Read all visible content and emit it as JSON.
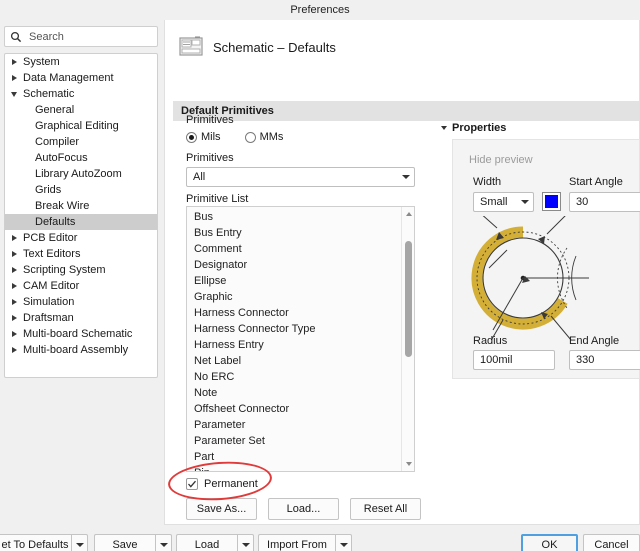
{
  "window": {
    "title": "Preferences"
  },
  "search": {
    "placeholder": "Search",
    "icon": "search-icon"
  },
  "sidebar": {
    "items": [
      {
        "label": "System",
        "level": 1,
        "expander": "right",
        "selected": false
      },
      {
        "label": "Data Management",
        "level": 1,
        "expander": "right",
        "selected": false
      },
      {
        "label": "Schematic",
        "level": 1,
        "expander": "down",
        "selected": false
      },
      {
        "label": "General",
        "level": 2,
        "expander": "none",
        "selected": false
      },
      {
        "label": "Graphical Editing",
        "level": 2,
        "expander": "none",
        "selected": false
      },
      {
        "label": "Compiler",
        "level": 2,
        "expander": "none",
        "selected": false
      },
      {
        "label": "AutoFocus",
        "level": 2,
        "expander": "none",
        "selected": false
      },
      {
        "label": "Library AutoZoom",
        "level": 2,
        "expander": "none",
        "selected": false
      },
      {
        "label": "Grids",
        "level": 2,
        "expander": "none",
        "selected": false
      },
      {
        "label": "Break Wire",
        "level": 2,
        "expander": "none",
        "selected": false
      },
      {
        "label": "Defaults",
        "level": 2,
        "expander": "none",
        "selected": true
      },
      {
        "label": "PCB Editor",
        "level": 1,
        "expander": "right",
        "selected": false
      },
      {
        "label": "Text Editors",
        "level": 1,
        "expander": "right",
        "selected": false
      },
      {
        "label": "Scripting System",
        "level": 1,
        "expander": "right",
        "selected": false
      },
      {
        "label": "CAM Editor",
        "level": 1,
        "expander": "right",
        "selected": false
      },
      {
        "label": "Simulation",
        "level": 1,
        "expander": "right",
        "selected": false
      },
      {
        "label": "Draftsman",
        "level": 1,
        "expander": "right",
        "selected": false
      },
      {
        "label": "Multi-board Schematic",
        "level": 1,
        "expander": "right",
        "selected": false
      },
      {
        "label": "Multi-board Assembly",
        "level": 1,
        "expander": "right",
        "selected": false
      }
    ]
  },
  "page": {
    "title": "Schematic – Defaults",
    "icon": "schematic-page-icon",
    "section_title": "Default Primitives"
  },
  "primitives": {
    "units_label": "Primitives",
    "units": [
      {
        "label": "Mils",
        "selected": true
      },
      {
        "label": "MMs",
        "selected": false
      }
    ],
    "filter_label": "Primitives",
    "filter_value": "All",
    "list_label": "Primitive List",
    "list_items": [
      "Bus",
      "Bus Entry",
      "Comment",
      "Designator",
      "Ellipse",
      "Graphic",
      "Harness Connector",
      "Harness Connector Type",
      "Harness Entry",
      "Net Label",
      "No ERC",
      "Note",
      "Offsheet Connector",
      "Parameter",
      "Parameter Set",
      "Part",
      "Pin"
    ],
    "permanent_label": "Permanent",
    "permanent_checked": true,
    "buttons": [
      {
        "label": "Save As..."
      },
      {
        "label": "Load..."
      },
      {
        "label": "Reset All"
      }
    ]
  },
  "properties": {
    "title": "Properties",
    "hide_preview": "Hide preview",
    "width_label": "Width",
    "width_value": "Small",
    "color_swatch": "#0000FF",
    "start_angle_label": "Start Angle",
    "start_angle_value": "30",
    "radius_label": "Radius",
    "radius_value": "100mil",
    "end_angle_label": "End Angle",
    "end_angle_value": "330",
    "preview_arc_color": "#d4af37"
  },
  "footer": {
    "reset_to_defaults": "et To Defaults",
    "save": "Save",
    "load": "Load",
    "import_from": "Import From",
    "ok": "OK",
    "cancel": "Cancel"
  },
  "annotation": {
    "shape": "red-ellipse",
    "color": "#E03A3A",
    "target": "permanent-checkbox"
  }
}
